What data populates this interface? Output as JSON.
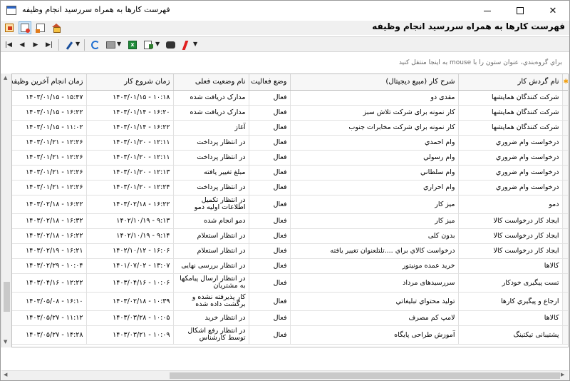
{
  "window": {
    "title": "فهرست کارها به همراه سررسید انجام وظیفه"
  },
  "header": {
    "page_title": "فهرست کارها به همراه سررسید انجام وظیفه"
  },
  "toolbar1": {
    "icons": [
      "exit-icon",
      "document-icon",
      "document-arrow-icon",
      "home-icon"
    ]
  },
  "toolbar2": {
    "icons": [
      "first-icon",
      "previous-icon",
      "next-icon",
      "last-icon",
      "wand-icon",
      "refresh-icon",
      "print-icon",
      "excel-icon",
      "export-icon",
      "binoculars-icon",
      "bolt-icon"
    ]
  },
  "groupby": {
    "hint": "براي گروه‌بندي، عنوان ستون را با mouse به اينجا منتقل کنيد"
  },
  "grid": {
    "columns": [
      "نام گردش کار",
      "شرح کار (مبیع دیجیتال)",
      "وضع فعالیت",
      "نام وضعیت فعلی",
      "زمان شروع کار",
      "زمان انجام آخرین وظیفه کار"
    ],
    "rows": [
      {
        "workflow": "شرکت کنندگان همایشها",
        "desc": "مقدی دو",
        "status": "فعال",
        "state": "مدارک دریافت شده",
        "start": "۱۰:۱۸ - ۱۴۰۳/۰۱/۱۵",
        "last": "۱۵:۴۷ - ۱۴۰۳/۰۱/۱۵"
      },
      {
        "workflow": "شرکت کنندگان همایشها",
        "desc": "کار نمونه برای شرکت تلاش سبز",
        "status": "فعال",
        "state": "مدارک دریافت شده",
        "start": "۱۶:۲۰ - ۱۴۰۳/۰۱/۱۴",
        "last": "۱۶:۲۲ - ۱۴۰۳/۰۱/۱۵"
      },
      {
        "workflow": "شرکت کنندگان همایشها",
        "desc": "کار نمونه براي شرکت مخابرات جنوب",
        "status": "فعال",
        "state": "آغاز",
        "start": "۱۶:۲۲ - ۱۴۰۳/۰۱/۱۴",
        "last": "۱۱:۰۲ - ۱۴۰۳/۰۱/۱۵"
      },
      {
        "workflow": "درخواست وام ضروري",
        "desc": "وام احمدي",
        "status": "فعال",
        "state": "در انتظار پرداخت",
        "start": "۱۲:۱۱ - ۱۴۰۳/۰۱/۲۰",
        "last": "۱۲:۲۶ - ۱۴۰۳/۰۱/۲۱"
      },
      {
        "workflow": "درخواست وام ضروري",
        "desc": "وام رسولي",
        "status": "فعال",
        "state": "در انتظار پرداخت",
        "start": "۱۲:۱۱ - ۱۴۰۳/۰۱/۲۰",
        "last": "۱۲:۲۶ - ۱۴۰۳/۰۱/۲۱"
      },
      {
        "workflow": "درخواست وام ضروري",
        "desc": "وام سلطاني",
        "status": "فعال",
        "state": "مبلغ تغيير يافته",
        "start": "۱۲:۱۳ - ۱۴۰۳/۰۱/۲۰",
        "last": "۱۲:۲۶ - ۱۴۰۳/۰۱/۲۱"
      },
      {
        "workflow": "درخواست وام ضروري",
        "desc": "وام احراري",
        "status": "فعال",
        "state": "در انتظار پرداخت",
        "start": "۱۲:۲۴ - ۱۴۰۳/۰۱/۲۰",
        "last": "۱۲:۲۶ - ۱۴۰۳/۰۱/۲۱"
      },
      {
        "workflow": "دمو",
        "desc": "میز کار",
        "status": "فعال",
        "state": "در انتظار تکمیل اطلاعات اولیه دمو",
        "start": "۱۶:۲۲ - ۱۴۰۳/۰۲/۱۸",
        "last": "۱۶:۲۲ - ۱۴۰۳/۰۲/۱۸"
      },
      {
        "workflow": "ایجاد کار درخواست کالا",
        "desc": "میز کار",
        "status": "فعال",
        "state": "دمو انجام شده",
        "start": "۹:۱۳ - ۱۴۰۲/۱۰/۱۹",
        "last": "۱۶:۳۲ - ۱۴۰۳/۰۲/۱۸"
      },
      {
        "workflow": "ایجاد کار درخواست کالا",
        "desc": "بدون کلی",
        "status": "فعال",
        "state": "در انتظار استعلام",
        "start": "۹:۱۴ - ۱۴۰۲/۱۰/۱۹",
        "last": "۱۶:۲۲ - ۱۴۰۳/۰۲/۱۸"
      },
      {
        "workflow": "ایجاد کار درخواست کالا",
        "desc": "درخواست کالاي براي ....تلتلعنوان تغییر یافته",
        "status": "فعال",
        "state": "در انتظار استعلام",
        "start": "۱۶:۰۶ - ۱۴۰۲/۱۰/۱۲",
        "last": "۱۶:۲۱ - ۱۴۰۳/۰۲/۱۹"
      },
      {
        "workflow": "کالاها",
        "desc": "خرید عمده مونیتور",
        "status": "فعال",
        "state": "در انتظار بررسی نهایی",
        "start": "۱۳:۰۷ - ۱۴۰۱/۰۷/۰۲",
        "last": "۱۰:۰۴ - ۱۴۰۳/۰۲/۲۹"
      },
      {
        "workflow": "تست پیگیری خودکار",
        "desc": "سررسیدهای مرداد",
        "status": "فعال",
        "state": "در انتظار ارسال پیامکها به مشتریان",
        "start": "۱۰:۰۶ - ۱۴۰۳/۰۴/۱۶",
        "last": "۱۲:۲۲ - ۱۴۰۳/۰۴/۱۶"
      },
      {
        "workflow": "ارجاع و پیگیري کارها",
        "desc": "تولید محتواي تبليغاتي",
        "status": "فعال",
        "state": "کار پذیرفته نشده و برگشت داده شده",
        "start": "۱۰:۳۹ - ۱۴۰۳/۰۲/۱۸",
        "last": "۱۶:۱۰ - ۱۴۰۳/۰۵/۰۸"
      },
      {
        "workflow": "کالاها",
        "desc": "لامپ کم مصرف",
        "status": "فعال",
        "state": "در انتظار خرید",
        "start": "۱۰:۰۵ - ۱۴۰۳/۰۳/۲۸",
        "last": "۱۱:۱۲ - ۱۴۰۳/۰۵/۲۷"
      },
      {
        "workflow": "پشتیبانی تیکتینگ",
        "desc": "آموزش طراحی پایگاه",
        "status": "فعال",
        "state": "در انتظار رفع اشکال توسط کارشناس",
        "start": "۱۰:۰۹ - ۱۴۰۳/۰۳/۲۱",
        "last": "۱۴:۲۸ - ۱۴۰۳/۰۵/۲۷"
      }
    ]
  },
  "colors": {
    "accent": "#cce4f7",
    "header_bg": "#f7f7f7",
    "grid_line": "#e1e1e1"
  }
}
